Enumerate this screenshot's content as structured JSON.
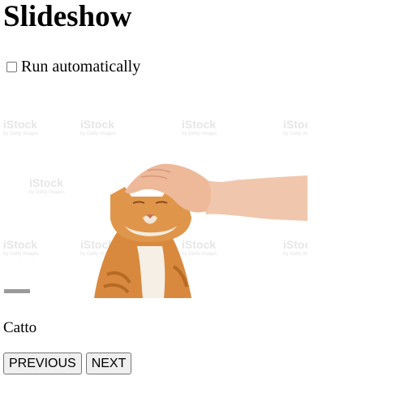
{
  "page": {
    "title": "Slideshow"
  },
  "autorun": {
    "label": "Run automatically",
    "checked": false
  },
  "slide": {
    "image_alt": "Orange cat being petted on the head by a hand",
    "watermark": "iStock",
    "watermark_sub": "by Getty Images",
    "caption": "Catto"
  },
  "controls": {
    "previous_label": "PREVIOUS",
    "next_label": "NEXT"
  }
}
